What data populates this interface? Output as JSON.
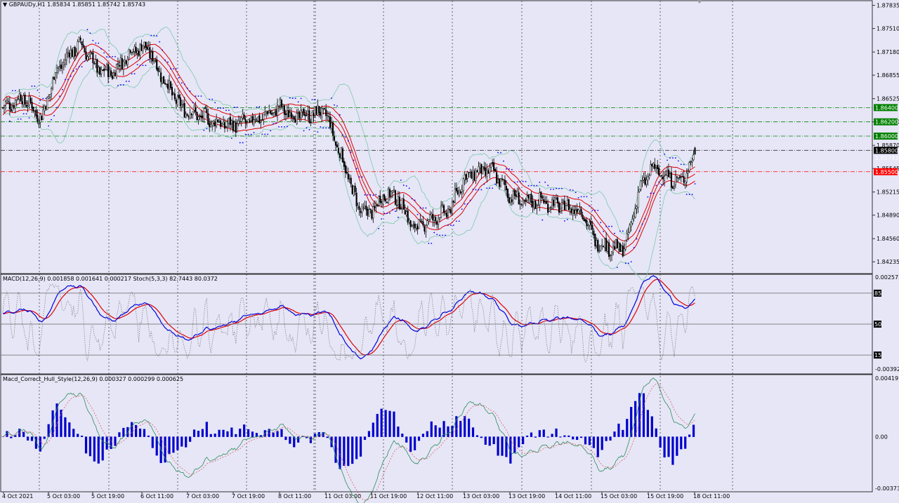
{
  "main_title": "GBPAUDy,H1  1.85834 1.85851 1.85742 1.85743",
  "macd_title": "MACD(12,26,9) 0.001858 0.001641 0.000217  Stoch(5,3,3) 82.7443 80.0372",
  "hull_title": "Macd_Correct_Hull_Style(12,26,9) 0.000327 0.000299 0.000625",
  "colors": {
    "background": "#e6e6f7",
    "grid": "#555555",
    "candle": "#000000",
    "bollinger": "#7fc8a9",
    "envelope": "#e00000",
    "sar": "#0000ff",
    "macd_main": "#0000dd",
    "macd_signal": "#e00000",
    "stoch": "#888888",
    "hist": "#0000cc",
    "hull_green": "#2e8b57",
    "hull_red": "#e06060",
    "level_green": "#008000",
    "level_red": "#ff0000",
    "current_price": "#000000"
  },
  "chart_data": [
    {
      "type": "candlestick",
      "title": "GBPAUDy,H1",
      "ohlc_last": {
        "open": 1.85834,
        "high": 1.85851,
        "low": 1.85742,
        "close": 1.85743
      },
      "ylim": [
        1.8407,
        1.879
      ],
      "y_ticks": [
        "1.87835",
        "1.87510",
        "1.87180",
        "1.86855",
        "1.86525",
        "1.86200",
        "1.85870",
        "1.85545",
        "1.85215",
        "1.84890",
        "1.84560",
        "1.84235"
      ],
      "x_ticks": [
        "4 Oct 2021",
        "5 Oct 03:00",
        "5 Oct 19:00",
        "6 Oct 11:00",
        "7 Oct 03:00",
        "7 Oct 19:00",
        "8 Oct 11:00",
        "11 Oct 03:00",
        "11 Oct 19:00",
        "12 Oct 11:00",
        "13 Oct 03:00",
        "13 Oct 19:00",
        "14 Oct 11:00",
        "15 Oct 03:00",
        "15 Oct 19:00",
        "18 Oct 11:00"
      ],
      "key_points": [
        [
          0,
          1.864
        ],
        [
          14,
          1.8655
        ],
        [
          28,
          1.8625
        ],
        [
          38,
          1.869
        ],
        [
          48,
          1.8715
        ],
        [
          56,
          1.873
        ],
        [
          70,
          1.869
        ],
        [
          80,
          1.869
        ],
        [
          92,
          1.872
        ],
        [
          104,
          1.8725
        ],
        [
          116,
          1.868
        ],
        [
          128,
          1.864
        ],
        [
          140,
          1.863
        ],
        [
          152,
          1.862
        ],
        [
          164,
          1.8615
        ],
        [
          178,
          1.862
        ],
        [
          190,
          1.863
        ],
        [
          200,
          1.864
        ],
        [
          210,
          1.8628
        ],
        [
          222,
          1.863
        ],
        [
          232,
          1.8635
        ],
        [
          246,
          1.856
        ],
        [
          256,
          1.85
        ],
        [
          264,
          1.849
        ],
        [
          276,
          1.852
        ],
        [
          286,
          1.851
        ],
        [
          296,
          1.847
        ],
        [
          306,
          1.848
        ],
        [
          316,
          1.849
        ],
        [
          322,
          1.8495
        ],
        [
          332,
          1.854
        ],
        [
          342,
          1.855
        ],
        [
          354,
          1.855
        ],
        [
          364,
          1.852
        ],
        [
          376,
          1.8505
        ],
        [
          386,
          1.851
        ],
        [
          396,
          1.8505
        ],
        [
          408,
          1.85
        ],
        [
          418,
          1.8495
        ],
        [
          426,
          1.8455
        ],
        [
          436,
          1.8445
        ],
        [
          444,
          1.844
        ],
        [
          450,
          1.845
        ],
        [
          458,
          1.852
        ],
        [
          468,
          1.8555
        ],
        [
          478,
          1.8545
        ],
        [
          488,
          1.8535
        ],
        [
          496,
          1.856
        ],
        [
          500,
          1.858
        ]
      ],
      "levels": [
        {
          "price": 1.864,
          "label": "1.86400",
          "color": "green"
        },
        {
          "price": 1.862,
          "label": "1.86200",
          "color": "green"
        },
        {
          "price": 1.86,
          "label": "1.86000",
          "color": "green"
        },
        {
          "price": 1.858,
          "label": "1.85800",
          "color": "black"
        },
        {
          "price": 1.855,
          "label": "1.85500",
          "color": "red"
        }
      ],
      "price_tags": [
        "1.86400",
        "1.86200",
        "1.86000",
        "1.85800",
        "1.85500"
      ],
      "current_price_label": "1.85743"
    },
    {
      "type": "line",
      "title": "MACD(12,26,9) / Stoch(5,3,3)",
      "series": [
        {
          "name": "MACD main",
          "last": 0.001858
        },
        {
          "name": "MACD signal",
          "last": 0.001641
        },
        {
          "name": "Stoch %K",
          "last": 82.7443
        },
        {
          "name": "Stoch %D",
          "last": 80.0372
        }
      ],
      "ylim": [
        -0.003926,
        0.002572
      ],
      "y_ticks": [
        "0.002572",
        "-0.003926"
      ],
      "stoch_levels": [
        "85",
        "50",
        "15"
      ]
    },
    {
      "type": "bar",
      "title": "Macd_Correct_Hull_Style(12,26,9)",
      "values_last": [
        0.000327,
        0.000299,
        0.000625
      ],
      "ylim": [
        -0.003736,
        0.004197
      ],
      "y_ticks": [
        "0.004197",
        "0.00",
        "-0.003736"
      ]
    }
  ]
}
